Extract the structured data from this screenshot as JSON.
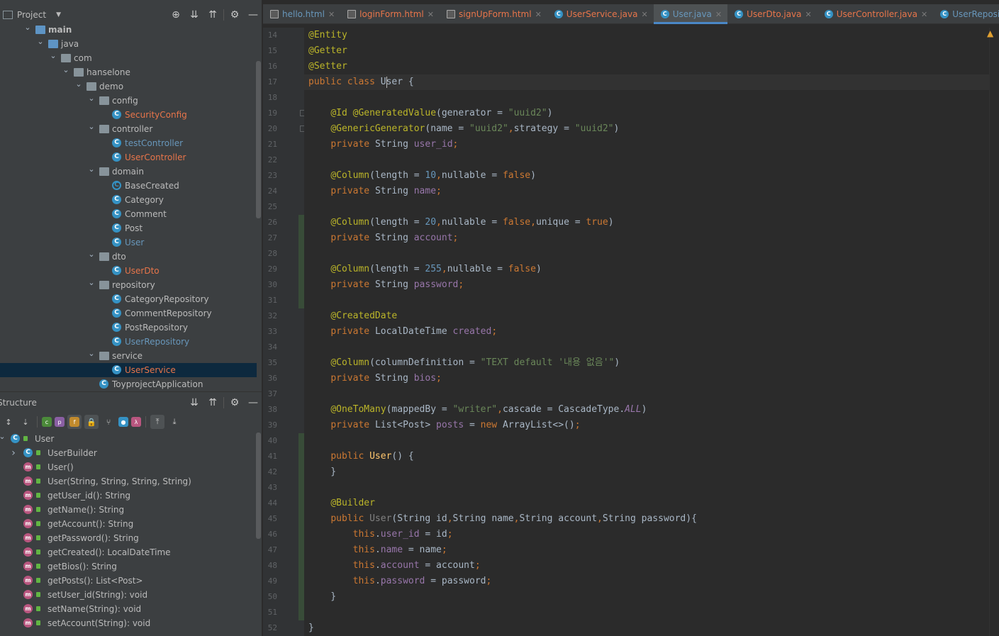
{
  "project_panel": {
    "title": "Project",
    "tree": [
      {
        "label": "main",
        "depth": 2,
        "kind": "folder-blue",
        "expanded": true,
        "bold": true
      },
      {
        "label": "java",
        "depth": 3,
        "kind": "folder-blue",
        "expanded": true
      },
      {
        "label": "com",
        "depth": 4,
        "kind": "folder",
        "expanded": true
      },
      {
        "label": "hanselone",
        "depth": 5,
        "kind": "folder",
        "expanded": true
      },
      {
        "label": "demo",
        "depth": 6,
        "kind": "folder",
        "expanded": true
      },
      {
        "label": "config",
        "depth": 7,
        "kind": "folder",
        "expanded": true
      },
      {
        "label": "SecurityConfig",
        "depth": 8,
        "kind": "class",
        "status": "modified"
      },
      {
        "label": "controller",
        "depth": 7,
        "kind": "folder",
        "expanded": true
      },
      {
        "label": "testController",
        "depth": 8,
        "kind": "class",
        "status": "added"
      },
      {
        "label": "UserController",
        "depth": 8,
        "kind": "class",
        "status": "modified"
      },
      {
        "label": "domain",
        "depth": 7,
        "kind": "folder",
        "expanded": true
      },
      {
        "label": "BaseCreated",
        "depth": 8,
        "kind": "abstract",
        "status": "normal"
      },
      {
        "label": "Category",
        "depth": 8,
        "kind": "class",
        "status": "normal"
      },
      {
        "label": "Comment",
        "depth": 8,
        "kind": "class",
        "status": "normal"
      },
      {
        "label": "Post",
        "depth": 8,
        "kind": "class",
        "status": "normal"
      },
      {
        "label": "User",
        "depth": 8,
        "kind": "class",
        "status": "added"
      },
      {
        "label": "dto",
        "depth": 7,
        "kind": "folder",
        "expanded": true
      },
      {
        "label": "UserDto",
        "depth": 8,
        "kind": "class",
        "status": "modified"
      },
      {
        "label": "repository",
        "depth": 7,
        "kind": "folder",
        "expanded": true
      },
      {
        "label": "CategoryRepository",
        "depth": 8,
        "kind": "class",
        "status": "normal"
      },
      {
        "label": "CommentRepository",
        "depth": 8,
        "kind": "class",
        "status": "normal"
      },
      {
        "label": "PostRepository",
        "depth": 8,
        "kind": "class",
        "status": "normal"
      },
      {
        "label": "UserRepository",
        "depth": 8,
        "kind": "class",
        "status": "added"
      },
      {
        "label": "service",
        "depth": 7,
        "kind": "folder",
        "expanded": true
      },
      {
        "label": "UserService",
        "depth": 8,
        "kind": "class",
        "status": "modified",
        "selected": true
      },
      {
        "label": "ToyprojectApplication",
        "depth": 7,
        "kind": "class",
        "status": "normal"
      }
    ]
  },
  "structure_panel": {
    "title": "Structure",
    "root": "User",
    "items": [
      {
        "label": "UserBuilder",
        "kind": "class",
        "expandable": true
      },
      {
        "label": "User()",
        "kind": "method"
      },
      {
        "label": "User(String, String, String, String)",
        "kind": "method"
      },
      {
        "label": "getUser_id(): String",
        "kind": "method"
      },
      {
        "label": "getName(): String",
        "kind": "method"
      },
      {
        "label": "getAccount(): String",
        "kind": "method"
      },
      {
        "label": "getPassword(): String",
        "kind": "method"
      },
      {
        "label": "getCreated(): LocalDateTime",
        "kind": "method"
      },
      {
        "label": "getBios(): String",
        "kind": "method"
      },
      {
        "label": "getPosts(): List<Post>",
        "kind": "method"
      },
      {
        "label": "setUser_id(String): void",
        "kind": "method"
      },
      {
        "label": "setName(String): void",
        "kind": "method"
      },
      {
        "label": "setAccount(String): void",
        "kind": "method"
      }
    ]
  },
  "tabs": [
    {
      "label": "hello.html",
      "type": "html",
      "color": "blue"
    },
    {
      "label": "loginForm.html",
      "type": "html",
      "color": "orange"
    },
    {
      "label": "signUpForm.html",
      "type": "html",
      "color": "orange"
    },
    {
      "label": "UserService.java",
      "type": "java",
      "color": "orange"
    },
    {
      "label": "User.java",
      "type": "java",
      "color": "blue",
      "active": true
    },
    {
      "label": "UserDto.java",
      "type": "java",
      "color": "orange"
    },
    {
      "label": "UserController.java",
      "type": "java",
      "color": "orange"
    },
    {
      "label": "UserRepository.java",
      "type": "java",
      "color": "blue"
    }
  ],
  "editor": {
    "first_line": 14,
    "current_line": 17,
    "lines": [
      [
        [
          "a",
          "@Entity"
        ]
      ],
      [
        [
          "a",
          "@Getter"
        ]
      ],
      [
        [
          "a",
          "@Setter"
        ]
      ],
      [
        [
          "k",
          "public class "
        ],
        [
          "p",
          "User {"
        ]
      ],
      [],
      [
        [
          "p",
          "    "
        ],
        [
          "a",
          "@Id @GeneratedValue"
        ],
        [
          "p",
          "(generator = "
        ],
        [
          "s",
          "\"uuid2\""
        ],
        [
          "p",
          ")"
        ]
      ],
      [
        [
          "p",
          "    "
        ],
        [
          "a",
          "@GenericGenerator"
        ],
        [
          "p",
          "(name = "
        ],
        [
          "s",
          "\"uuid2\""
        ],
        [
          "k",
          ","
        ],
        [
          "p",
          "strategy = "
        ],
        [
          "s",
          "\"uuid2\""
        ],
        [
          "p",
          ")"
        ]
      ],
      [
        [
          "p",
          "    "
        ],
        [
          "k",
          "private "
        ],
        [
          "p",
          "String "
        ],
        [
          "f",
          "user_id"
        ],
        [
          "k",
          ";"
        ]
      ],
      [],
      [
        [
          "p",
          "    "
        ],
        [
          "a",
          "@Column"
        ],
        [
          "p",
          "(length = "
        ],
        [
          "n",
          "10"
        ],
        [
          "k",
          ","
        ],
        [
          "p",
          "nullable = "
        ],
        [
          "k",
          "false"
        ],
        [
          "p",
          ")"
        ]
      ],
      [
        [
          "p",
          "    "
        ],
        [
          "k",
          "private "
        ],
        [
          "p",
          "String "
        ],
        [
          "f",
          "name"
        ],
        [
          "k",
          ";"
        ]
      ],
      [],
      [
        [
          "p",
          "    "
        ],
        [
          "a",
          "@Column"
        ],
        [
          "p",
          "(length = "
        ],
        [
          "n",
          "20"
        ],
        [
          "k",
          ","
        ],
        [
          "p",
          "nullable = "
        ],
        [
          "k",
          "false"
        ],
        [
          "k",
          ","
        ],
        [
          "p",
          "unique = "
        ],
        [
          "k",
          "true"
        ],
        [
          "p",
          ")"
        ]
      ],
      [
        [
          "p",
          "    "
        ],
        [
          "k",
          "private "
        ],
        [
          "p",
          "String "
        ],
        [
          "f",
          "account"
        ],
        [
          "k",
          ";"
        ]
      ],
      [],
      [
        [
          "p",
          "    "
        ],
        [
          "a",
          "@Column"
        ],
        [
          "p",
          "(length = "
        ],
        [
          "n",
          "255"
        ],
        [
          "k",
          ","
        ],
        [
          "p",
          "nullable = "
        ],
        [
          "k",
          "false"
        ],
        [
          "p",
          ")"
        ]
      ],
      [
        [
          "p",
          "    "
        ],
        [
          "k",
          "private "
        ],
        [
          "p",
          "String "
        ],
        [
          "f",
          "password"
        ],
        [
          "k",
          ";"
        ]
      ],
      [],
      [
        [
          "p",
          "    "
        ],
        [
          "a",
          "@CreatedDate"
        ]
      ],
      [
        [
          "p",
          "    "
        ],
        [
          "k",
          "private "
        ],
        [
          "p",
          "LocalDateTime "
        ],
        [
          "f",
          "created"
        ],
        [
          "k",
          ";"
        ]
      ],
      [],
      [
        [
          "p",
          "    "
        ],
        [
          "a",
          "@Column"
        ],
        [
          "p",
          "(columnDefinition = "
        ],
        [
          "s",
          "\"TEXT default '내용 없음'\""
        ],
        [
          "p",
          ")"
        ]
      ],
      [
        [
          "p",
          "    "
        ],
        [
          "k",
          "private "
        ],
        [
          "p",
          "String "
        ],
        [
          "f",
          "bios"
        ],
        [
          "k",
          ";"
        ]
      ],
      [],
      [
        [
          "p",
          "    "
        ],
        [
          "a",
          "@OneToMany"
        ],
        [
          "p",
          "(mappedBy = "
        ],
        [
          "s",
          "\"writer\""
        ],
        [
          "k",
          ","
        ],
        [
          "p",
          "cascade = CascadeType."
        ],
        [
          "it",
          "ALL"
        ],
        [
          "p",
          ")"
        ]
      ],
      [
        [
          "p",
          "    "
        ],
        [
          "k",
          "private "
        ],
        [
          "p",
          "List<Post> "
        ],
        [
          "f",
          "posts "
        ],
        [
          "p",
          "= "
        ],
        [
          "k",
          "new "
        ],
        [
          "p",
          "ArrayList<>()"
        ],
        [
          "k",
          ";"
        ]
      ],
      [],
      [
        [
          "p",
          "    "
        ],
        [
          "k",
          "public "
        ],
        [
          "fn",
          "User"
        ],
        [
          "p",
          "() {"
        ]
      ],
      [
        [
          "p",
          "    }"
        ]
      ],
      [],
      [
        [
          "p",
          "    "
        ],
        [
          "a",
          "@Builder"
        ]
      ],
      [
        [
          "p",
          "    "
        ],
        [
          "k",
          "public "
        ],
        [
          "gr",
          "User"
        ],
        [
          "p",
          "(String id"
        ],
        [
          "k",
          ","
        ],
        [
          "p",
          "String name"
        ],
        [
          "k",
          ","
        ],
        [
          "p",
          "String account"
        ],
        [
          "k",
          ","
        ],
        [
          "p",
          "String password){"
        ]
      ],
      [
        [
          "p",
          "        "
        ],
        [
          "k",
          "this"
        ],
        [
          "p",
          "."
        ],
        [
          "f",
          "user_id"
        ],
        [
          "p",
          " = id"
        ],
        [
          "k",
          ";"
        ]
      ],
      [
        [
          "p",
          "        "
        ],
        [
          "k",
          "this"
        ],
        [
          "p",
          "."
        ],
        [
          "f",
          "name"
        ],
        [
          "p",
          " = name"
        ],
        [
          "k",
          ";"
        ]
      ],
      [
        [
          "p",
          "        "
        ],
        [
          "k",
          "this"
        ],
        [
          "p",
          "."
        ],
        [
          "f",
          "account"
        ],
        [
          "p",
          " = account"
        ],
        [
          "k",
          ";"
        ]
      ],
      [
        [
          "p",
          "        "
        ],
        [
          "k",
          "this"
        ],
        [
          "p",
          "."
        ],
        [
          "f",
          "password"
        ],
        [
          "p",
          " = password"
        ],
        [
          "k",
          ";"
        ]
      ],
      [
        [
          "p",
          "    }"
        ]
      ],
      [],
      [
        [
          "p",
          "}"
        ]
      ]
    ]
  },
  "colors": {
    "accent": "#4a88c7",
    "modified": "#e8754a",
    "added": "#6897bb",
    "selection": "#0d293e"
  }
}
